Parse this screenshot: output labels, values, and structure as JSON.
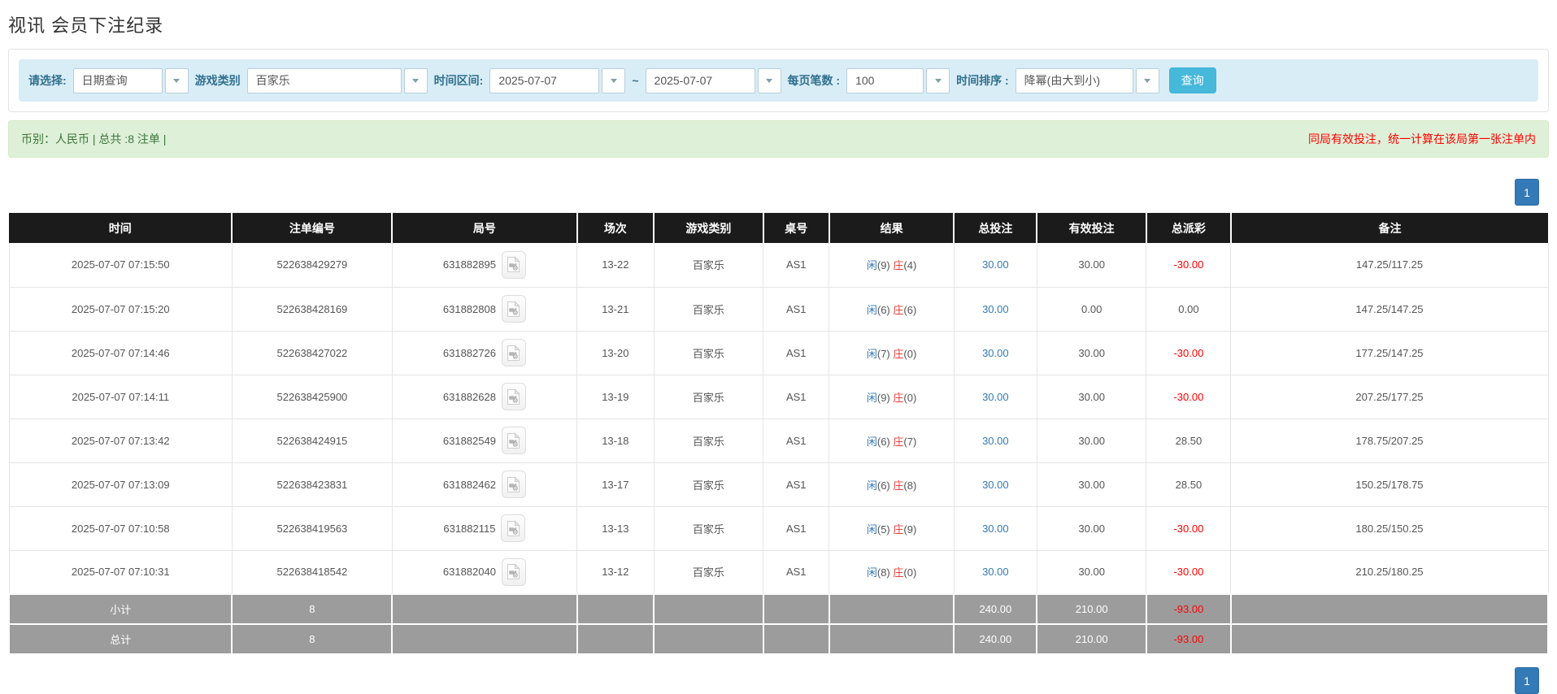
{
  "page": {
    "title": "视讯 会员下注纪录"
  },
  "filters": {
    "query_type": {
      "label": "请选择:",
      "value": "日期查询"
    },
    "game_category": {
      "label": "游戏类别",
      "value": "百家乐"
    },
    "date_range": {
      "label": "时间区间:",
      "from": "2025-07-07",
      "separator": "~",
      "to": "2025-07-07"
    },
    "page_size": {
      "label": "每页笔数 :",
      "value": "100"
    },
    "time_order": {
      "label": "时间排序 :",
      "value": "降幂(由大到小)"
    },
    "search_button": "查询"
  },
  "summary": {
    "left_text": "币别：人民币 | 总共 :8 注单 |",
    "right_note": "同局有效投注，统一计算在该局第一张注单内"
  },
  "pagination": {
    "page": "1"
  },
  "icons": {
    "video": "video-file-icon",
    "caret": "chevron-down-icon"
  },
  "colors": {
    "header_bg": "#1b1b1b",
    "footer_bg": "#9c9c9c",
    "accent_blue": "#337ab7",
    "query_button_blue": "#46b8da",
    "player_blue": "#337ab7",
    "banker_red": "#e8403a",
    "negative_red": "#ff0000",
    "summary_green_text": "#3c763d",
    "summary_green_bg": "#dff0d8",
    "filter_bar_bg": "#d9edf7"
  },
  "table": {
    "headers": [
      "时间",
      "注单编号",
      "局号",
      "场次",
      "游戏类别",
      "桌号",
      "结果",
      "总投注",
      "有效投注",
      "总派彩",
      "备注"
    ],
    "rows": [
      {
        "time": "2025-07-07 07:15:50",
        "bet_id": "522638429279",
        "round_id": "631882895",
        "session": "13-22",
        "game": "百家乐",
        "table_no": "AS1",
        "result": {
          "player": "闲",
          "player_score": "(9)",
          "banker": "庄",
          "banker_score": "(4)"
        },
        "total_bet": "30.00",
        "valid_bet": "30.00",
        "payout": "-30.00",
        "remark": "147.25/117.25"
      },
      {
        "time": "2025-07-07 07:15:20",
        "bet_id": "522638428169",
        "round_id": "631882808",
        "session": "13-21",
        "game": "百家乐",
        "table_no": "AS1",
        "result": {
          "player": "闲",
          "player_score": "(6)",
          "banker": "庄",
          "banker_score": "(6)"
        },
        "total_bet": "30.00",
        "valid_bet": "0.00",
        "payout": "0.00",
        "remark": "147.25/147.25"
      },
      {
        "time": "2025-07-07 07:14:46",
        "bet_id": "522638427022",
        "round_id": "631882726",
        "session": "13-20",
        "game": "百家乐",
        "table_no": "AS1",
        "result": {
          "player": "闲",
          "player_score": "(7)",
          "banker": "庄",
          "banker_score": "(0)"
        },
        "total_bet": "30.00",
        "valid_bet": "30.00",
        "payout": "-30.00",
        "remark": "177.25/147.25"
      },
      {
        "time": "2025-07-07 07:14:11",
        "bet_id": "522638425900",
        "round_id": "631882628",
        "session": "13-19",
        "game": "百家乐",
        "table_no": "AS1",
        "result": {
          "player": "闲",
          "player_score": "(9)",
          "banker": "庄",
          "banker_score": "(0)"
        },
        "total_bet": "30.00",
        "valid_bet": "30.00",
        "payout": "-30.00",
        "remark": "207.25/177.25"
      },
      {
        "time": "2025-07-07 07:13:42",
        "bet_id": "522638424915",
        "round_id": "631882549",
        "session": "13-18",
        "game": "百家乐",
        "table_no": "AS1",
        "result": {
          "player": "闲",
          "player_score": "(6)",
          "banker": "庄",
          "banker_score": "(7)"
        },
        "total_bet": "30.00",
        "valid_bet": "30.00",
        "payout": "28.50",
        "remark": "178.75/207.25"
      },
      {
        "time": "2025-07-07 07:13:09",
        "bet_id": "522638423831",
        "round_id": "631882462",
        "session": "13-17",
        "game": "百家乐",
        "table_no": "AS1",
        "result": {
          "player": "闲",
          "player_score": "(6)",
          "banker": "庄",
          "banker_score": "(8)"
        },
        "total_bet": "30.00",
        "valid_bet": "30.00",
        "payout": "28.50",
        "remark": "150.25/178.75"
      },
      {
        "time": "2025-07-07 07:10:58",
        "bet_id": "522638419563",
        "round_id": "631882115",
        "session": "13-13",
        "game": "百家乐",
        "table_no": "AS1",
        "result": {
          "player": "闲",
          "player_score": "(5)",
          "banker": "庄",
          "banker_score": "(9)"
        },
        "total_bet": "30.00",
        "valid_bet": "30.00",
        "payout": "-30.00",
        "remark": "180.25/150.25"
      },
      {
        "time": "2025-07-07 07:10:31",
        "bet_id": "522638418542",
        "round_id": "631882040",
        "session": "13-12",
        "game": "百家乐",
        "table_no": "AS1",
        "result": {
          "player": "闲",
          "player_score": "(8)",
          "banker": "庄",
          "banker_score": "(0)"
        },
        "total_bet": "30.00",
        "valid_bet": "30.00",
        "payout": "-30.00",
        "remark": "210.25/180.25"
      }
    ],
    "footer": [
      {
        "label": "小计",
        "count": "8",
        "total_bet": "240.00",
        "valid_bet": "210.00",
        "payout": "-93.00"
      },
      {
        "label": "总计",
        "count": "8",
        "total_bet": "240.00",
        "valid_bet": "210.00",
        "payout": "-93.00"
      }
    ]
  }
}
